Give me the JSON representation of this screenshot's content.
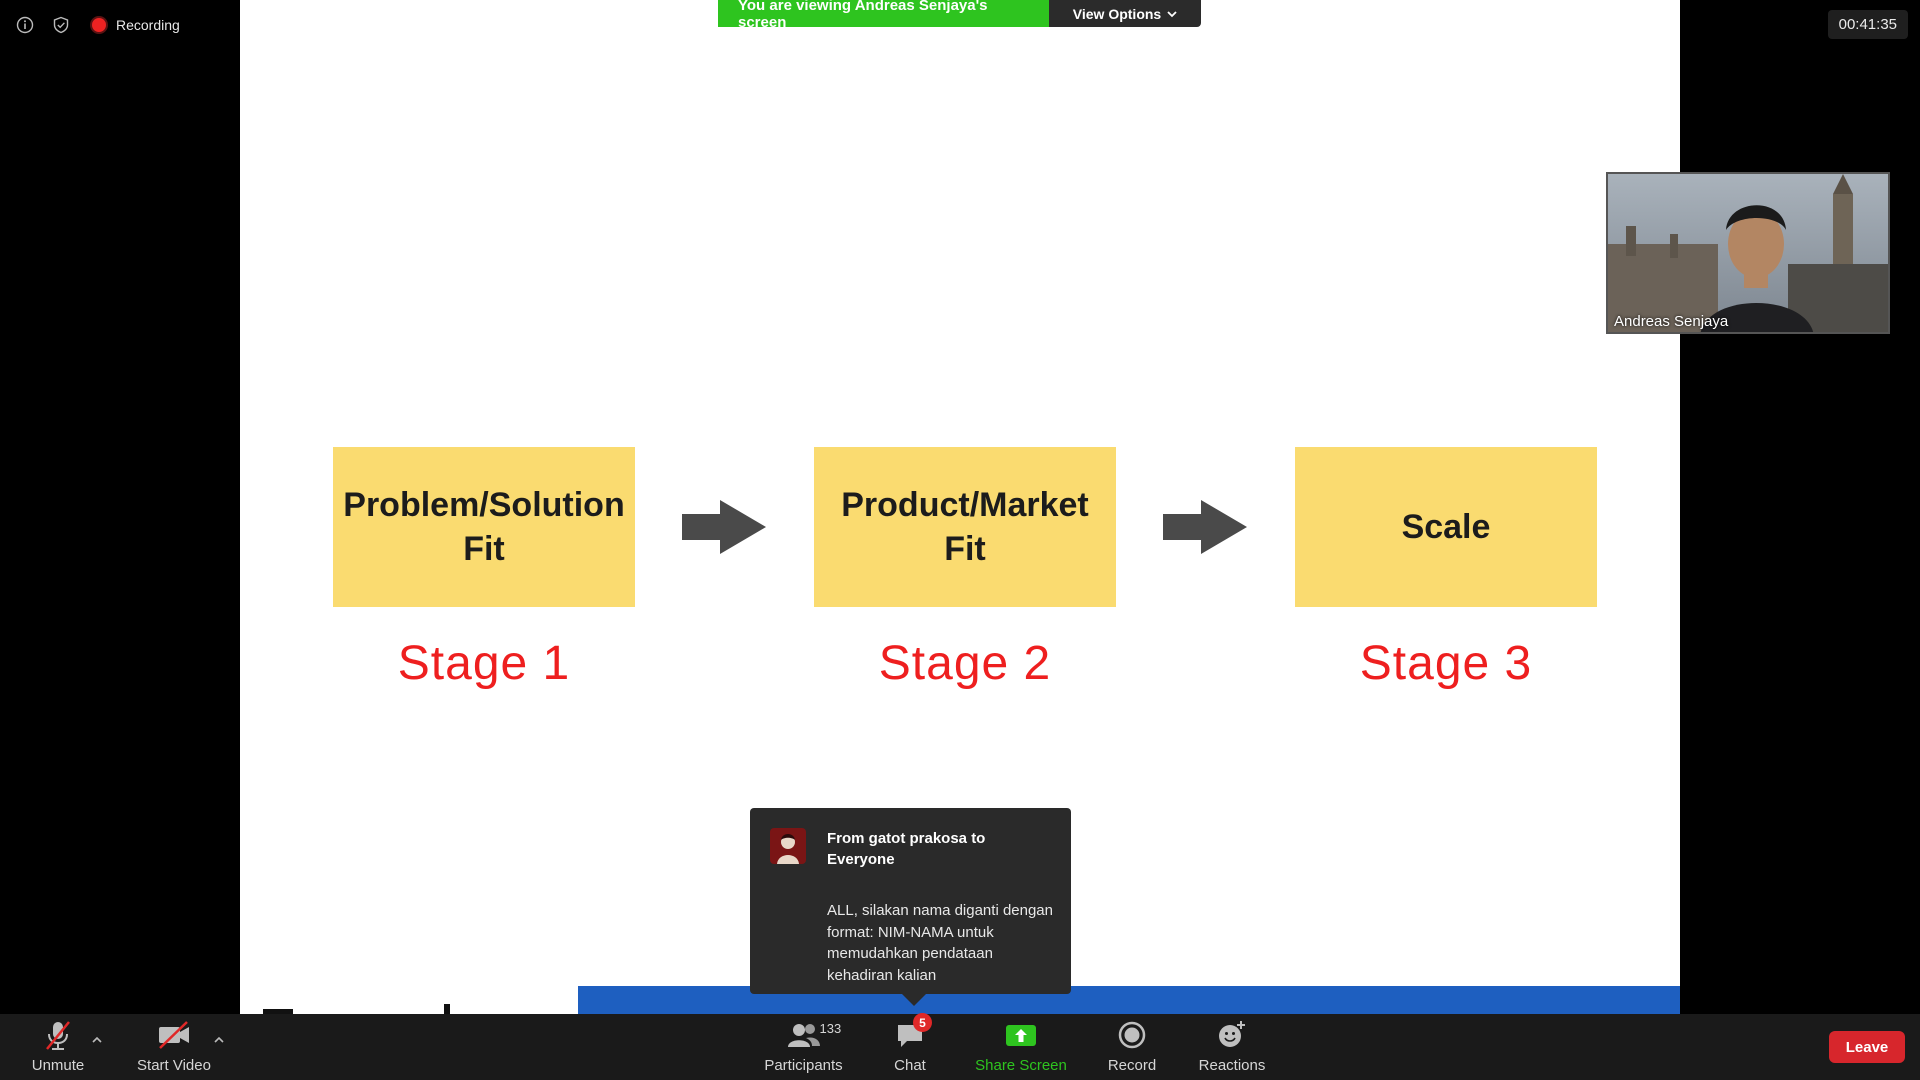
{
  "top_bar": {
    "recording_label": "Recording",
    "timer": "00:41:35",
    "icons": [
      "info-icon",
      "shield-icon",
      "recording-icon"
    ]
  },
  "share_banner": {
    "viewing_text": "You are viewing Andreas Senjaya's screen",
    "view_options_label": "View Options"
  },
  "slide": {
    "boxes": [
      {
        "line1": "Problem/Solution",
        "line2": "Fit"
      },
      {
        "line1": "Product/Market",
        "line2": "Fit"
      },
      {
        "line1": "Scale",
        "line2": ""
      }
    ],
    "stages": [
      "Stage 1",
      "Stage 2",
      "Stage 3"
    ],
    "colors": {
      "box": "#fadb70",
      "stage_text": "#ee1f1f",
      "arrow": "#4a4a4a",
      "bottom_bar": "#1e5fc0"
    }
  },
  "video": {
    "participant_name": "Andreas Senjaya"
  },
  "chat_toast": {
    "title": "From gatot prakosa to Everyone",
    "message": "ALL, silakan nama diganti dengan format: NIM-NAMA untuk memudahkan pendataan kehadiran kalian"
  },
  "toolbar": {
    "unmute_label": "Unmute",
    "start_video_label": "Start Video",
    "participants_label": "Participants",
    "participants_count": "133",
    "chat_label": "Chat",
    "chat_badge": "5",
    "share_screen_label": "Share Screen",
    "record_label": "Record",
    "reactions_label": "Reactions",
    "leave_label": "Leave",
    "colors": {
      "share": "#2ec41f",
      "leave": "#d7262c",
      "badge": "#e02828"
    }
  }
}
